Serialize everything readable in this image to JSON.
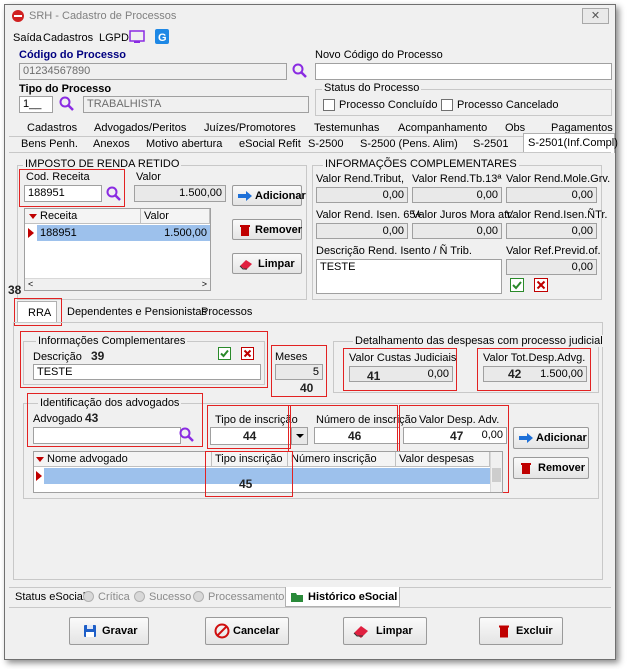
{
  "window": {
    "title": "SRH - Cadastro de Processos",
    "close": "✕"
  },
  "menu": {
    "items": [
      "Saída",
      "Cadastros",
      "LGPD"
    ]
  },
  "header": {
    "cod_processo_label": "Código do Processo",
    "cod_processo_value": "01234567890",
    "novo_codigo_label": "Novo Código do Processo",
    "novo_codigo_value": "",
    "tipo_processo_label": "Tipo do Processo",
    "tipo_processo_code": "1__",
    "tipo_processo_desc": "TRABALHISTA",
    "status_label": "Status do Processo",
    "status_concluido": "Processo Concluído",
    "status_cancelado": "Processo Cancelado"
  },
  "tabs_row1": [
    "Cadastros",
    "Advogados/Peritos",
    "Juízes/Promotores",
    "Testemunhas",
    "Acompanhamento",
    "Obs",
    "Pagamentos"
  ],
  "tabs_row2": [
    "Bens Penh.",
    "Anexos",
    "Motivo abertura",
    "eSocial Refit",
    "S-2500",
    "S-2500 (Pens. Alim)",
    "S-2501",
    "S-2501(Inf.Compl)"
  ],
  "imposto": {
    "title": "IMPOSTO DE RENDA RETIDO",
    "cod_receita_label": "Cod. Receita",
    "cod_receita_value": "188951",
    "valor_label": "Valor",
    "valor_value": "1.500,00",
    "grid_headers": [
      "Receita",
      "Valor"
    ],
    "grid_rows": [
      {
        "receita": "188951",
        "valor": "1.500,00"
      }
    ],
    "btn_adicionar": "Adicionar",
    "btn_remover": "Remover",
    "btn_limpar": "Limpar"
  },
  "info_compl": {
    "title": "INFORMAÇÕES COMPLEMENTARES",
    "fields_row1": [
      {
        "label": "Valor Rend.Tribut,",
        "value": "0,00"
      },
      {
        "label": "Valor Rend.Tb.13ª",
        "value": "0,00"
      },
      {
        "label": "Valor Rend.Mole.Grv.",
        "value": "0,00"
      }
    ],
    "fields_row2": [
      {
        "label": "Valor Rend. Isen. 65+",
        "value": "0,00"
      },
      {
        "label": "Valor Juros Mora atr.",
        "value": "0,00"
      },
      {
        "label": "Valor Rend.Isen.ÑTr.",
        "value": "0,00"
      }
    ],
    "desc_label": "Descrição Rend. Isento / Ñ Trib.",
    "desc_value": "TESTE",
    "ref_previd_label": "Valor Ref.Previd.of.",
    "ref_previd_value": "0,00"
  },
  "annotations": {
    "a38": "38",
    "a39": "39",
    "a40": "40",
    "a41": "41",
    "a42": "42",
    "a43": "43",
    "a44": "44",
    "a45": "45",
    "a46": "46",
    "a47": "47"
  },
  "subtabs": [
    "RRA",
    "Dependentes e Pensionistas",
    "Processos"
  ],
  "rra": {
    "info_title": "Informações Complementares",
    "descricao_label": "Descrição",
    "descricao_value": "TESTE",
    "meses_label": "Meses",
    "meses_value": "5",
    "despesas_title": "Detalhamento das despesas com processo judicial",
    "custas_label": "Valor Custas Judiciais",
    "custas_value": "0,00",
    "tot_desp_label": "Valor Tot.Desp.Advg.",
    "tot_desp_value": "1.500,00",
    "adv_title": "Identificação dos advogados",
    "advogado_label": "Advogado",
    "advogado_value": "",
    "tipo_insc_label": "Tipo de inscrição",
    "num_insc_label": "Número de inscrição",
    "desp_adv_label": "Valor Desp. Adv.",
    "desp_adv_value": "0,00",
    "btn_adicionar": "Adicionar",
    "btn_remover": "Remover",
    "grid_headers": [
      "Nome advogado",
      "Tipo inscrição",
      "Número inscrição",
      "Valor despesas"
    ]
  },
  "esocial_status": {
    "label": "Status eSocial:",
    "critica": "Crítica",
    "sucesso": "Sucesso",
    "processamento": "Processamento",
    "historico": "Histórico eSocial"
  },
  "footer": {
    "gravar": "Gravar",
    "cancelar": "Cancelar",
    "limpar": "Limpar",
    "excluir": "Excluir"
  },
  "colors": {
    "accent_red": "#e22222",
    "selection_blue": "#9dc1ec",
    "icon_purple": "#8a2be2",
    "icon_blue": "#1e88e5"
  }
}
